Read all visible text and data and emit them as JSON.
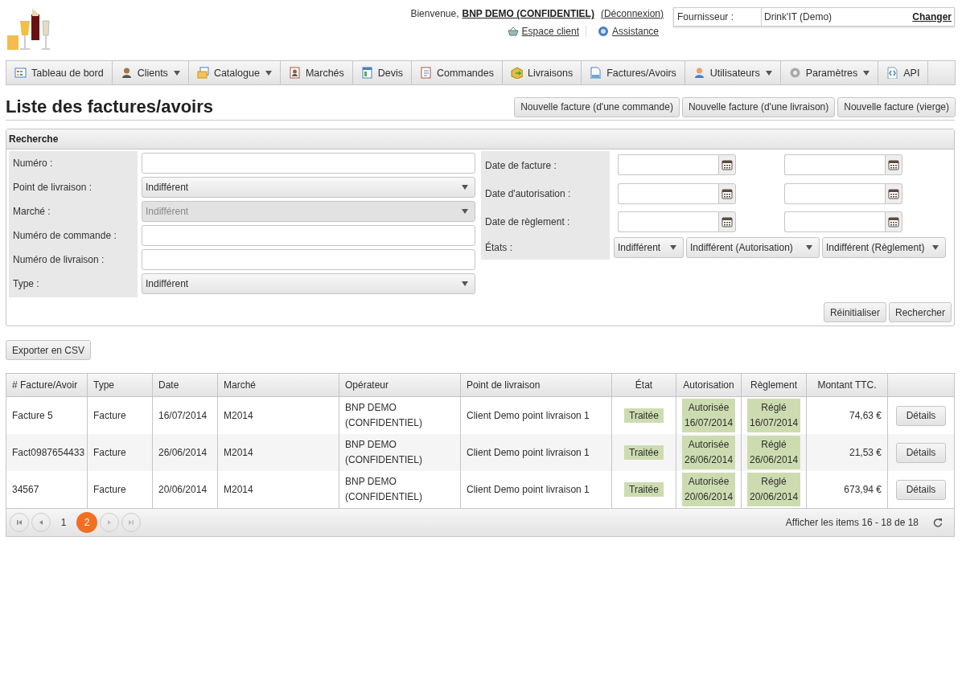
{
  "header": {
    "welcome": "Bienvenue,",
    "user": "BNP DEMO (CONFIDENTIEL)",
    "logout": "(Déconnexion)",
    "links": [
      {
        "label": "Espace client"
      },
      {
        "label": "Assistance"
      }
    ],
    "supplier": {
      "label": "Fournisseur :",
      "value": "Drink'IT (Demo)",
      "action": "Changer"
    }
  },
  "nav": [
    {
      "label": "Tableau de bord",
      "dropdown": false
    },
    {
      "label": "Clients",
      "dropdown": true
    },
    {
      "label": "Catalogue",
      "dropdown": true
    },
    {
      "label": "Marchés",
      "dropdown": false
    },
    {
      "label": "Devis",
      "dropdown": false
    },
    {
      "label": "Commandes",
      "dropdown": false
    },
    {
      "label": "Livraisons",
      "dropdown": false
    },
    {
      "label": "Factures/Avoirs",
      "dropdown": false
    },
    {
      "label": "Utilisateurs",
      "dropdown": true
    },
    {
      "label": "Paramètres",
      "dropdown": true
    },
    {
      "label": "API",
      "dropdown": false
    }
  ],
  "page_title": "Liste des factures/avoirs",
  "actions": [
    "Nouvelle facture (d'une commande)",
    "Nouvelle facture (d'une livraison)",
    "Nouvelle facture (vierge)"
  ],
  "search": {
    "title": "Recherche",
    "left_fields": [
      {
        "label": "Numéro :",
        "kind": "text",
        "disabled": false
      },
      {
        "label": "Point de livraison :",
        "kind": "select",
        "value": "Indifférent",
        "disabled": false
      },
      {
        "label": "Marché :",
        "kind": "select",
        "value": "Indifférent",
        "disabled": true
      },
      {
        "label": "Numéro de commande :",
        "kind": "text",
        "disabled": false
      },
      {
        "label": "Numéro de livraison :",
        "kind": "text",
        "disabled": false
      },
      {
        "label": "Type :",
        "kind": "select",
        "value": "Indifférent",
        "disabled": false
      }
    ],
    "date_fields": [
      {
        "label": "Date de facture :"
      },
      {
        "label": "Date d'autorisation :"
      },
      {
        "label": "Date de règlement :"
      }
    ],
    "states": {
      "label": "États :",
      "selects": [
        "Indifférent",
        "Indifférent (Autorisation)",
        "Indifférent (Règlement)"
      ]
    },
    "buttons": [
      "Réinitialiser",
      "Rechercher"
    ]
  },
  "export_button": "Exporter en CSV",
  "table": {
    "columns": [
      "# Facture/Avoir",
      "Type",
      "Date",
      "Marché",
      "Opérateur",
      "Point de livraison",
      "État",
      "Autorisation",
      "Règlement",
      "Montant TTC."
    ],
    "rows": [
      {
        "number": "Facture 5",
        "type": "Facture",
        "date": "16/07/2014",
        "market": "M2014",
        "operator": "BNP DEMO (CONFIDENTIEL)",
        "delivery_point": "Client Demo point livraison 1",
        "state": "Traitée",
        "authorization": {
          "label": "Autorisée",
          "date": "16/07/2014"
        },
        "payment": {
          "label": "Réglé",
          "date": "16/07/2014"
        },
        "amount": "74,63 €",
        "action": "Détails"
      },
      {
        "number": "Fact0987654433",
        "type": "Facture",
        "date": "26/06/2014",
        "market": "M2014",
        "operator": "BNP DEMO (CONFIDENTIEL)",
        "delivery_point": "Client Demo point livraison 1",
        "state": "Traitée",
        "authorization": {
          "label": "Autorisée",
          "date": "26/06/2014"
        },
        "payment": {
          "label": "Réglé",
          "date": "26/06/2014"
        },
        "amount": "21,53 €",
        "action": "Détails"
      },
      {
        "number": "34567",
        "type": "Facture",
        "date": "20/06/2014",
        "market": "M2014",
        "operator": "BNP DEMO (CONFIDENTIEL)",
        "delivery_point": "Client Demo point livraison 1",
        "state": "Traitée",
        "authorization": {
          "label": "Autorisée",
          "date": "20/06/2014"
        },
        "payment": {
          "label": "Réglé",
          "date": "20/06/2014"
        },
        "amount": "673,94 €",
        "action": "Détails"
      }
    ]
  },
  "pagination": {
    "pages": [
      {
        "label": "1",
        "selected": false
      },
      {
        "label": "2",
        "selected": true
      }
    ],
    "summary": "Afficher les items 16 - 18 de 18"
  }
}
